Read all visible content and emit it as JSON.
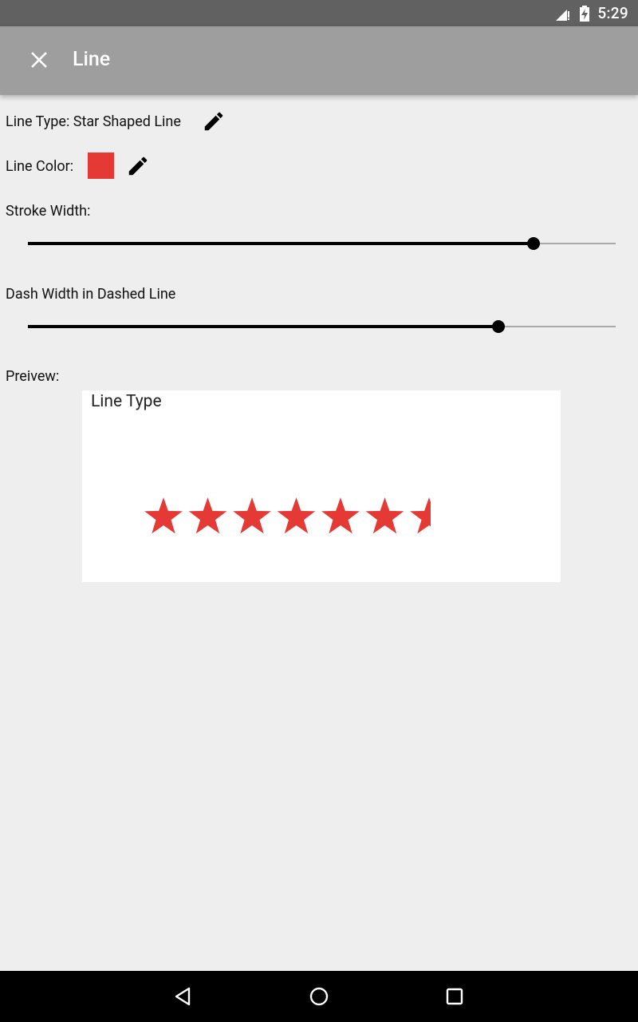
{
  "status_bar": {
    "time": "5:29",
    "icons": [
      "signal-icon",
      "battery-charging-icon"
    ]
  },
  "app_bar": {
    "title": "Line",
    "close_icon": "close-icon"
  },
  "settings": {
    "line_type_label": "Line Type: Star Shaped Line",
    "line_color_label": "Line Color:",
    "line_color": "#e53935",
    "stroke_width_label": "Stroke Width:",
    "stroke_width_value": 0.86,
    "dash_width_label": "Dash Width in Dashed Line",
    "dash_width_value": 0.8,
    "edit_icon": "pencil-icon"
  },
  "preview": {
    "label": "Preivew:",
    "card_label": "Line Type",
    "star_color": "#e53935",
    "star_count": 7
  },
  "nav_bar": {
    "icons": [
      "back-icon",
      "home-icon",
      "recents-icon"
    ]
  }
}
